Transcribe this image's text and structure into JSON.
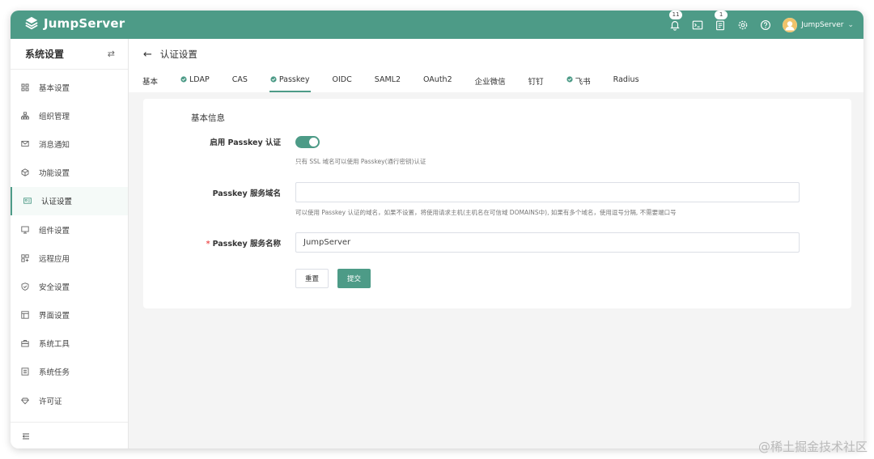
{
  "app": {
    "name": "JumpServer"
  },
  "topbar": {
    "notifications_badge": "11",
    "tasks_badge": "1",
    "user_name": "JumpServer",
    "icons": [
      "bell-icon",
      "terminal-icon",
      "clipboard-icon",
      "gear-icon",
      "help-icon"
    ]
  },
  "sidebar": {
    "title": "系统设置",
    "items": [
      {
        "label": "基本设置",
        "icon": "grid-icon"
      },
      {
        "label": "组织管理",
        "icon": "org-icon"
      },
      {
        "label": "消息通知",
        "icon": "message-icon"
      },
      {
        "label": "功能设置",
        "icon": "cube-icon"
      },
      {
        "label": "认证设置",
        "icon": "id-card-icon",
        "active": true
      },
      {
        "label": "组件设置",
        "icon": "monitor-icon"
      },
      {
        "label": "远程应用",
        "icon": "apps-icon"
      },
      {
        "label": "安全设置",
        "icon": "shield-icon"
      },
      {
        "label": "界面设置",
        "icon": "layout-icon"
      },
      {
        "label": "系统工具",
        "icon": "toolbox-icon"
      },
      {
        "label": "系统任务",
        "icon": "list-icon"
      },
      {
        "label": "许可证",
        "icon": "diamond-icon"
      }
    ]
  },
  "page": {
    "title": "认证设置",
    "tabs": [
      {
        "label": "基本",
        "enabled": false
      },
      {
        "label": "LDAP",
        "enabled": true
      },
      {
        "label": "CAS",
        "enabled": false
      },
      {
        "label": "Passkey",
        "enabled": true,
        "active": true
      },
      {
        "label": "OIDC",
        "enabled": false
      },
      {
        "label": "SAML2",
        "enabled": false
      },
      {
        "label": "OAuth2",
        "enabled": false
      },
      {
        "label": "企业微信",
        "enabled": false
      },
      {
        "label": "钉钉",
        "enabled": false
      },
      {
        "label": "飞书",
        "enabled": true
      },
      {
        "label": "Radius",
        "enabled": false
      }
    ]
  },
  "form": {
    "section_title": "基本信息",
    "enable_label": "启用 Passkey 认证",
    "enable_value": true,
    "enable_hint": "只有 SSL 域名可以使用 Passkey(通行密钥)认证",
    "domain_label": "Passkey 服务域名",
    "domain_value": "",
    "domain_hint": "可以使用 Passkey 认证的域名，如果不设置，将使用请求主机(主机名在可信域 DOMAINS中), 如果有多个域名，使用逗号分隔, 不需要端口号",
    "name_required_mark": "*",
    "name_label": "Passkey 服务名称",
    "name_value": "JumpServer",
    "reset_label": "重置",
    "submit_label": "提交"
  },
  "watermark": "@稀土掘金技术社区",
  "colors": {
    "primary": "#4d9b87",
    "required": "#e55555"
  }
}
